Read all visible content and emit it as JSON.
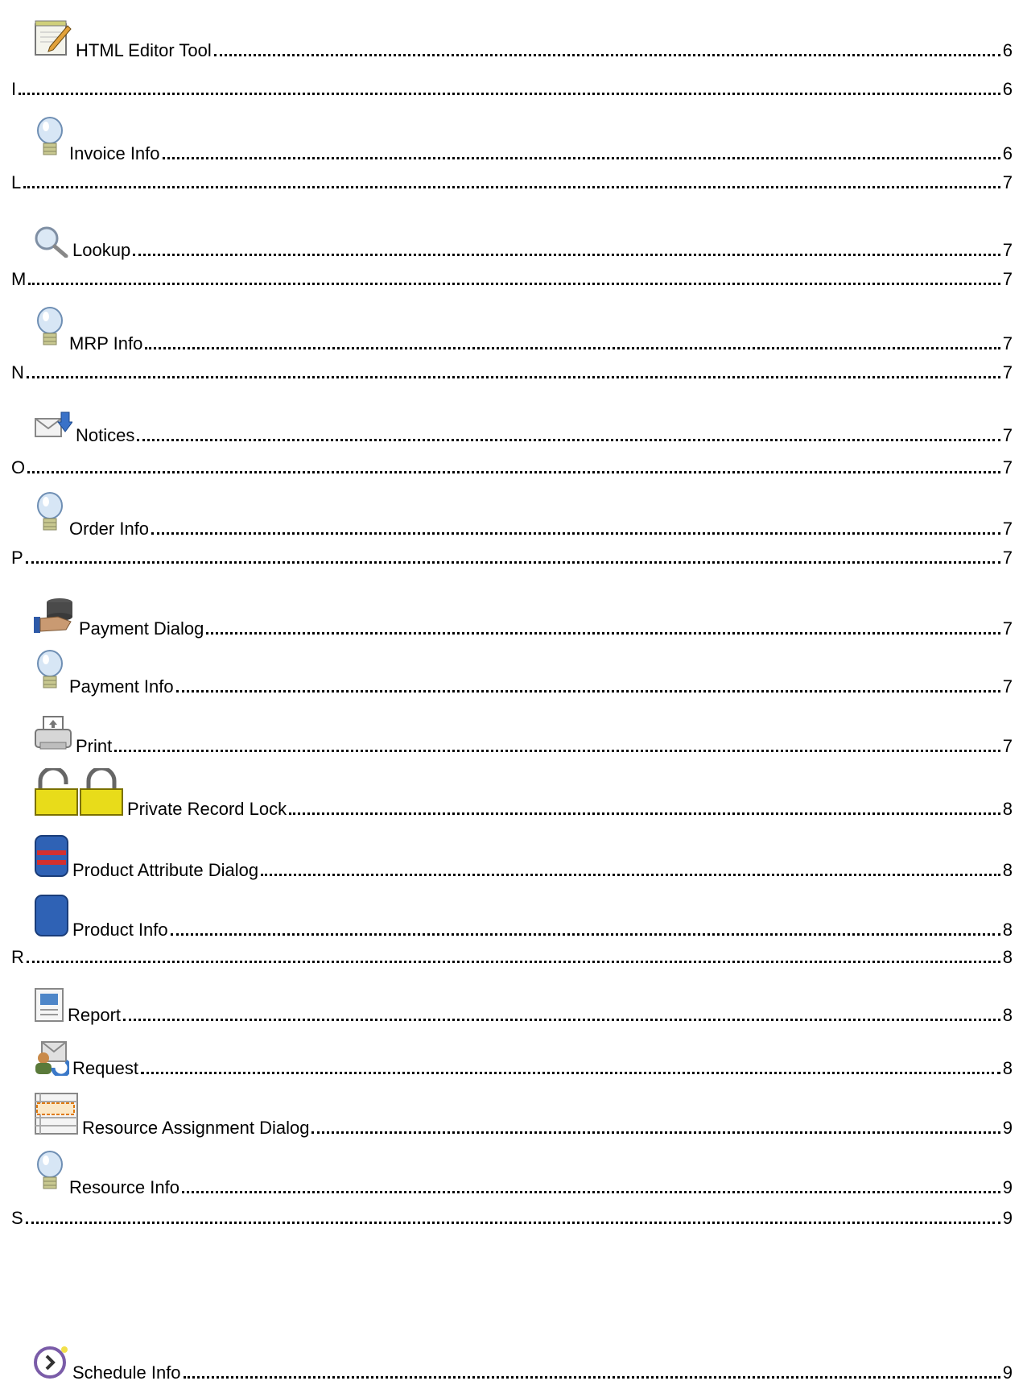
{
  "toc": {
    "entries": [
      {
        "label": "HTML Editor Tool",
        "page": "6",
        "icon": "notepad-pencil-icon"
      },
      {
        "label": "I",
        "page": "6"
      },
      {
        "label": "Invoice Info",
        "page": "6",
        "icon": "lightbulb-icon"
      },
      {
        "label": "L",
        "page": "7"
      },
      {
        "label": "Lookup",
        "page": "7",
        "icon": "magnifier-icon"
      },
      {
        "label": "M",
        "page": "7"
      },
      {
        "label": "MRP Info",
        "page": "7",
        "icon": "lightbulb-icon"
      },
      {
        "label": "N",
        "page": "7"
      },
      {
        "label": "Notices",
        "page": "7",
        "icon": "envelope-arrow-icon"
      },
      {
        "label": "O",
        "page": "7"
      },
      {
        "label": "Order Info",
        "page": "7",
        "icon": "lightbulb-icon"
      },
      {
        "label": "P",
        "page": "7"
      },
      {
        "label": "Payment Dialog",
        "page": "7",
        "icon": "payment-hand-icon"
      },
      {
        "label": "Payment Info",
        "page": "7",
        "icon": "lightbulb-icon"
      },
      {
        "label": "Print",
        "page": "7",
        "icon": "printer-icon"
      },
      {
        "label": "Private Record Lock",
        "page": "8",
        "icon": "padlocks-icon"
      },
      {
        "label": "Product Attribute Dialog",
        "page": "8",
        "icon": "product-attribute-icon"
      },
      {
        "label": "Product Info",
        "page": "8",
        "icon": "product-icon"
      },
      {
        "label": "R",
        "page": "8"
      },
      {
        "label": "Report",
        "page": "8",
        "icon": "report-icon"
      },
      {
        "label": "Request",
        "page": "8",
        "icon": "request-icon"
      },
      {
        "label": "Resource Assignment Dialog",
        "page": "9",
        "icon": "resource-grid-icon"
      },
      {
        "label": "Resource Info",
        "page": "9",
        "icon": "lightbulb-icon"
      },
      {
        "label": "S",
        "page": "9"
      },
      {
        "label": "Schedule Info",
        "page": "9",
        "icon": "clock-schedule-icon"
      }
    ]
  }
}
